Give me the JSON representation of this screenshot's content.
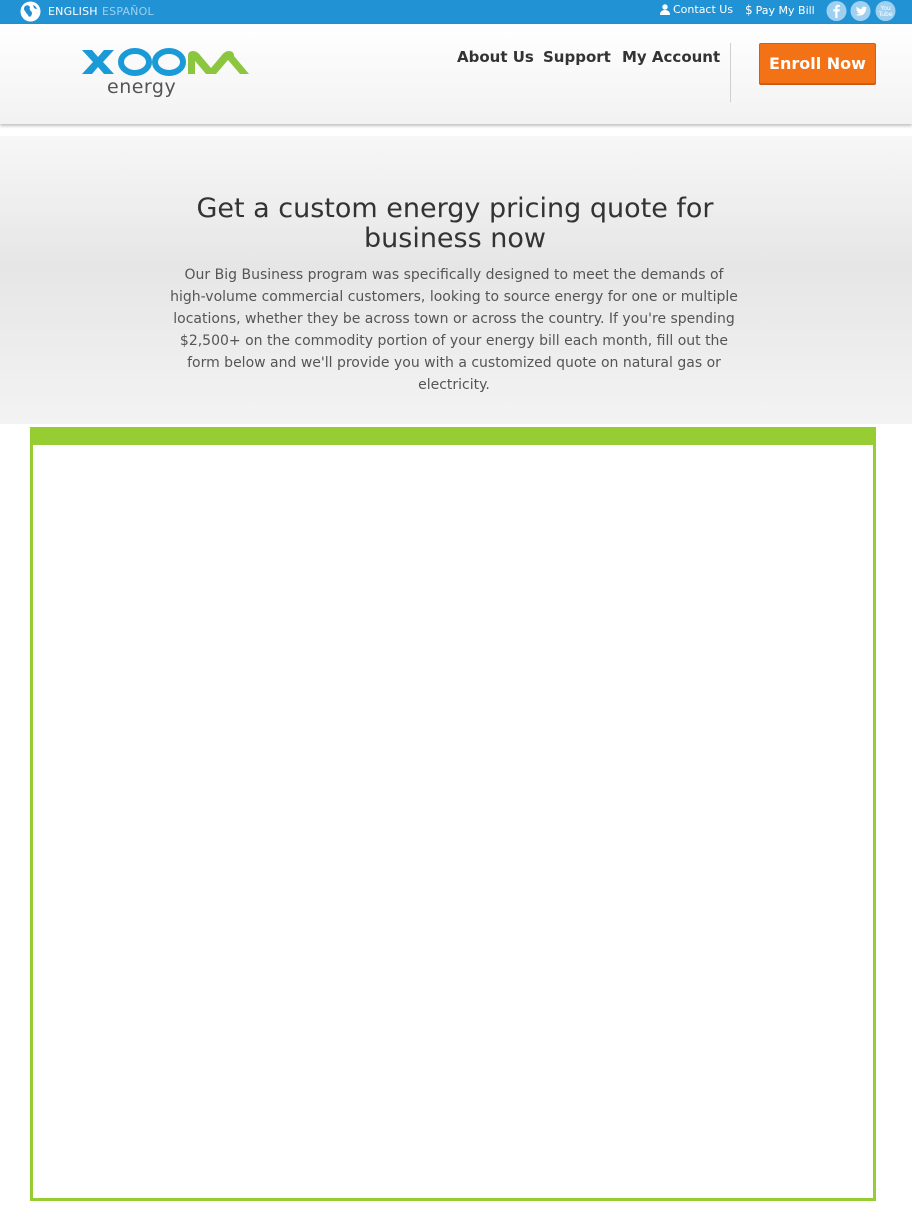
{
  "topbar": {
    "lang_en": "ENGLISH",
    "lang_es": "ESPAÑOL",
    "contact": "Contact Us",
    "pay": "Pay My Bill",
    "icons": [
      "globe-icon",
      "user-icon",
      "dollar-icon",
      "facebook-icon",
      "twitter-icon",
      "youtube-icon"
    ]
  },
  "header": {
    "logo_word": "energy",
    "nav": [
      "About Us",
      "Support",
      "My Account"
    ],
    "enroll": "Enroll Now"
  },
  "hero": {
    "title": "Get a custom energy pricing quote for business now",
    "text": "Our Big Business program was specifically designed to meet the demands of high-volume commercial customers, looking to source energy for one or multiple locations, whether they be across town or across the country. If you're spending $2,500+ on the commodity portion of your energy bill each month, fill out the form below and we'll provide you with a customized quote on natural gas or electricity."
  },
  "colors": {
    "topbar": "#2192d4",
    "logo_blue": "#1a9ad6",
    "logo_green": "#8cc63f",
    "enroll": "#f47216",
    "frame": "#96cd33"
  }
}
